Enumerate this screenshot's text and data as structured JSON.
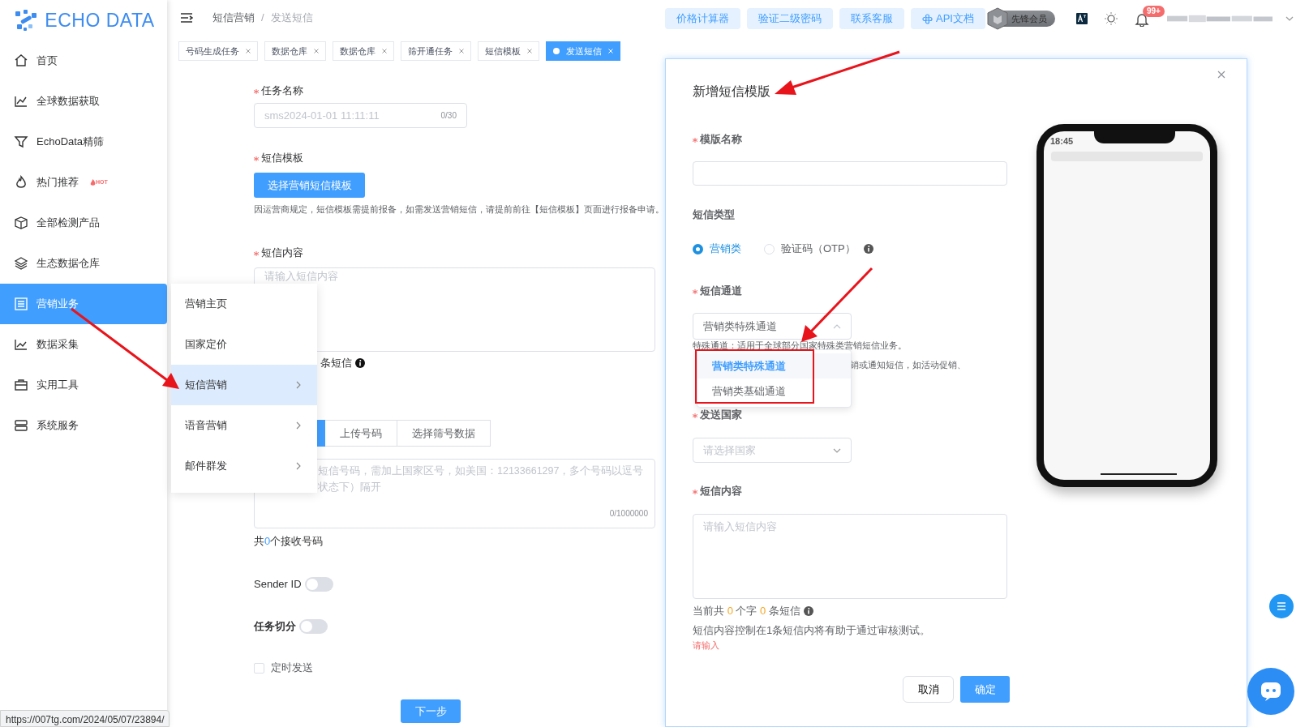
{
  "logo": {
    "text": "ECHO DATA"
  },
  "sidebar": {
    "items": [
      {
        "label": "首页",
        "selected": false
      },
      {
        "label": "全球数据获取",
        "selected": false
      },
      {
        "label": "EchoData精筛",
        "selected": false
      },
      {
        "label": "热门推荐",
        "selected": false,
        "badge": "HOT"
      },
      {
        "label": "全部检测产品",
        "selected": false
      },
      {
        "label": "生态数据仓库",
        "selected": false
      },
      {
        "label": "营销业务",
        "selected": true
      },
      {
        "label": "数据采集",
        "selected": false
      },
      {
        "label": "实用工具",
        "selected": false
      },
      {
        "label": "系统服务",
        "selected": false
      }
    ]
  },
  "header": {
    "breadcrumb": [
      "短信营销",
      "发送短信"
    ],
    "breadcrumb_separator": "/",
    "buttons": [
      {
        "label": "价格计算器",
        "kind": "plain"
      },
      {
        "label": "验证二级密码",
        "kind": "plain"
      },
      {
        "label": "联系客服",
        "kind": "plain"
      },
      {
        "label": "API文档",
        "kind": "api"
      }
    ],
    "member_badge": "先锋会员",
    "notification_count": "99+"
  },
  "tabs": [
    {
      "label": "号码生成任务",
      "selected": false
    },
    {
      "label": "数据仓库",
      "selected": false
    },
    {
      "label": "数据仓库",
      "selected": false
    },
    {
      "label": "筛开通任务",
      "selected": false
    },
    {
      "label": "短信模板",
      "selected": false
    },
    {
      "label": "发送短信",
      "selected": true
    }
  ],
  "form": {
    "task_name_label": "任务名称",
    "task_name_placeholder": "sms2024-01-01 11:11:11",
    "task_name_counter": "0/30",
    "template_label": "短信模板",
    "template_button": "选择营销短信模板",
    "template_hint": "因运营商规定，短信模板需提前报备，如需发送营销短信，请提前前往【短信模板】页面进行报备申请。",
    "content_label": "短信内容",
    "content_placeholder": "请输入短信内容",
    "content_count_tail": "条短信",
    "source_tabs": [
      {
        "label": "上传号码",
        "selected": false
      },
      {
        "label": "选择筛号数据",
        "selected": false
      }
    ],
    "numbers_placeholder": [
      "短信号码，需加上国家区号，如美国：12133661297，多个号码以逗号",
      "状态下）隔开"
    ],
    "numbers_counter": "0/1000000",
    "total": {
      "prefix": "共",
      "count": "0",
      "suffix": "个接收号码"
    },
    "sender_id": {
      "label": "Sender ID",
      "on": false
    },
    "task_split": {
      "label": "任务切分",
      "on": false
    },
    "scheduled": {
      "label": "定时发送",
      "checked": false
    },
    "next_button": "下一步"
  },
  "submenu": {
    "items": [
      {
        "label": "营销主页",
        "selected": false,
        "has_children": false
      },
      {
        "label": "国家定价",
        "selected": false,
        "has_children": false
      },
      {
        "label": "短信营销",
        "selected": true,
        "has_children": true
      },
      {
        "label": "语音营销",
        "selected": false,
        "has_children": true
      },
      {
        "label": "邮件群发",
        "selected": false,
        "has_children": true
      }
    ]
  },
  "modal": {
    "title": "新增短信模版",
    "name_label": "模版名称",
    "type_label": "短信类型",
    "types": [
      {
        "label": "营销类",
        "selected": true
      },
      {
        "label": "验证码（OTP）",
        "selected": false
      }
    ],
    "channel_label": "短信通道",
    "channel_value": "营销类特殊通道",
    "channel_expanded": true,
    "channel_hints": [
      "特殊通道：适用于全球部分国家特殊类营销短信业务。",
      "销或通知短信，如活动促销、"
    ],
    "channel_options": [
      {
        "label": "营销类特殊通道",
        "selected": true
      },
      {
        "label": "营销类基础通道",
        "selected": false
      }
    ],
    "country_label": "发送国家",
    "country_placeholder": "请选择国家",
    "content_label": "短信内容",
    "content_placeholder": "请输入短信内容",
    "counter": {
      "prefix": "当前共",
      "chars": "0",
      "mid": "个字",
      "sms": "0",
      "suffix": "条短信"
    },
    "note": "短信内容控制在1条短信内将有助于通过审核测试。",
    "error": "请输入",
    "cancel": "取消",
    "confirm": "确定",
    "phone_time": "18:45"
  },
  "status_url": "https://007tg.com/2024/05/07/23894/"
}
